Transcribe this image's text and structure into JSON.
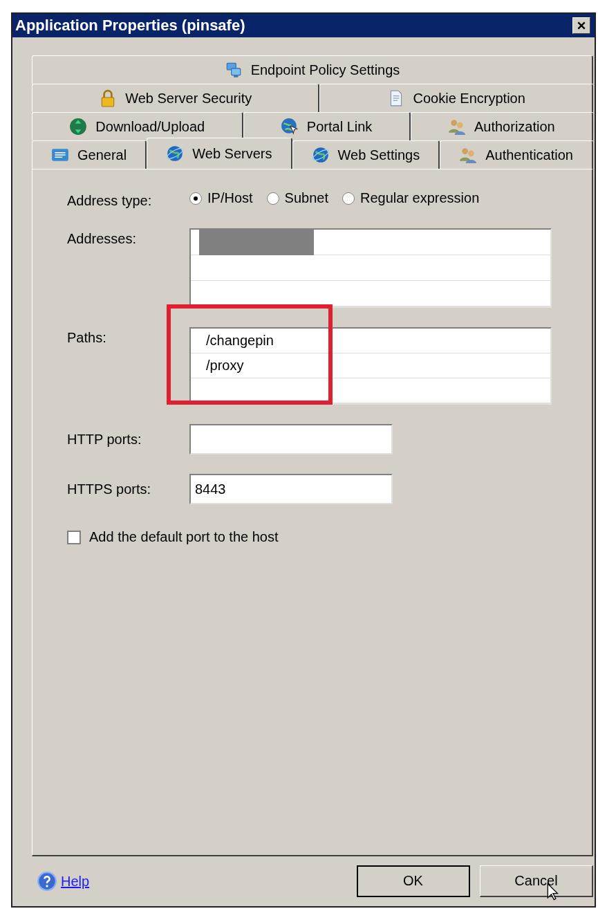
{
  "window": {
    "title": "Application Properties (pinsafe)"
  },
  "tab_rows": [
    [
      {
        "label": "Endpoint Policy Settings",
        "kind": "computers",
        "selected": false
      }
    ],
    [
      {
        "label": "Web Server Security",
        "kind": "lock",
        "selected": false
      },
      {
        "label": "Cookie Encryption",
        "kind": "document",
        "selected": false
      }
    ],
    [
      {
        "label": "Download/Upload",
        "kind": "arrows",
        "selected": false
      },
      {
        "label": "Portal Link",
        "kind": "link",
        "selected": false
      },
      {
        "label": "Authorization",
        "kind": "users",
        "selected": false
      }
    ],
    [
      {
        "label": "General",
        "kind": "form",
        "selected": false
      },
      {
        "label": "Web Servers",
        "kind": "globe",
        "selected": true
      },
      {
        "label": "Web Settings",
        "kind": "globe",
        "selected": false
      },
      {
        "label": "Authentication",
        "kind": "users",
        "selected": false
      }
    ]
  ],
  "address_type": {
    "label": "Address type:",
    "options": [
      {
        "label": "IP/Host",
        "selected": true
      },
      {
        "label": "Subnet",
        "selected": false
      },
      {
        "label": "Regular expression",
        "selected": false
      }
    ]
  },
  "addresses": {
    "label": "Addresses:",
    "rows": [
      {
        "redacted": true
      },
      {
        "redacted": false
      },
      {
        "redacted": false
      }
    ]
  },
  "paths": {
    "label": "Paths:",
    "highlighted": true,
    "rows": [
      "/changepin",
      "/proxy"
    ]
  },
  "http_ports": {
    "label": "HTTP ports:"
  },
  "https_ports": {
    "label": "HTTPS ports:",
    "value": "8443"
  },
  "default_port": {
    "label": "Add the default port to the host",
    "checked": false
  },
  "help": {
    "label": "Help"
  },
  "buttons": [
    {
      "label": "OK",
      "default": true,
      "hovered": false
    },
    {
      "label": "Cancel",
      "default": false,
      "hovered": true
    }
  ]
}
